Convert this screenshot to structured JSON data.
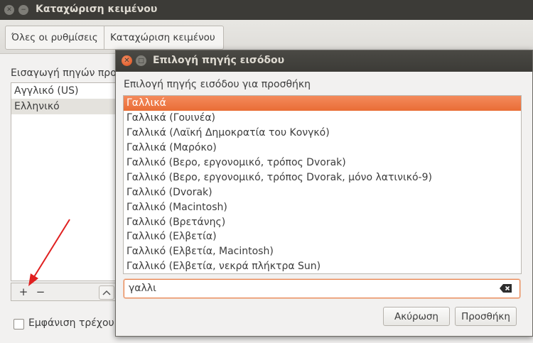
{
  "background_window": {
    "title": "Καταχώριση κειμένου",
    "breadcrumb": [
      "Όλες οι ρυθμίσεις",
      "Καταχώριση κειμένου"
    ],
    "sources_label": "Εισαγωγή πηγών προ",
    "sources": [
      "Αγγλικό (US)",
      "Ελληνικό"
    ],
    "add_symbol": "+",
    "remove_symbol": "−",
    "up_symbol": "︿",
    "show_current_label": "Εμφάνιση τρέχου"
  },
  "dialog": {
    "title": "Επιλογή πηγής εισόδου",
    "prompt": "Επιλογή πηγής εισόδου για προσθήκη",
    "items": [
      "Γαλλικά",
      "Γαλλικά (Γουινέα)",
      "Γαλλικά (Λαϊκή Δημοκρατία του Κονγκό)",
      "Γαλλικά (Μαρόκο)",
      "Γαλλικό (Βερο, εργονομικό, τρόπος Dvorak)",
      "Γαλλικό (Βερο, εργονομικό, τρόπος Dvorak, μόνο λατινικό-9)",
      "Γαλλικό (Dvorak)",
      "Γαλλικό (Macintosh)",
      "Γαλλικό (Βρετάνης)",
      "Γαλλικό (Ελβετία)",
      "Γαλλικό (Ελβετία, Macintosh)",
      "Γαλλικό (Ελβετία, νεκρά πλήκτρα Sun)"
    ],
    "selected_index": 0,
    "search_value": "γαλλι",
    "cancel_label": "Ακύρωση",
    "add_label": "Προσθήκη"
  },
  "colors": {
    "accent": "#e96d36",
    "titlebar": "#3c3b37",
    "arrow": "#e02020"
  }
}
